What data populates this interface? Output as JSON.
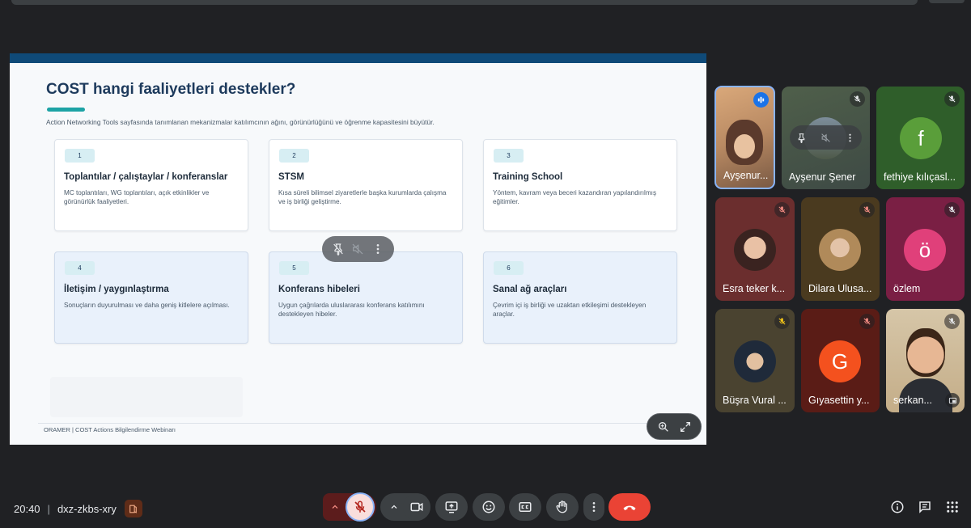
{
  "slide": {
    "title": "COST hangi faaliyetleri destekler?",
    "subtitle": "Action Networking Tools sayfasında tanımlanan mekanizmalar katılımcının ağını, görünürlüğünü ve öğrenme kapasitesini büyütür.",
    "footer": "ORAMER | COST Actions Bilgilendirme Webinarı",
    "cards": [
      {
        "num": "1",
        "title": "Toplantılar / çalıştaylar / konferanslar",
        "desc": "MC toplantıları, WG toplantıları, açık etkinlikler ve görünürlük faaliyetleri."
      },
      {
        "num": "2",
        "title": "STSM",
        "desc": "Kısa süreli bilimsel ziyaretlerle başka kurumlarda çalışma ve iş birliği geliştirme."
      },
      {
        "num": "3",
        "title": "Training School",
        "desc": "Yöntem, kavram veya beceri kazandıran yapılandırılmış eğitimler."
      },
      {
        "num": "4",
        "title": "İletişim / yaygınlaştırma",
        "desc": "Sonuçların duyurulması ve daha geniş kitlelere açılması."
      },
      {
        "num": "5",
        "title": "Konferans hibeleri",
        "desc": "Uygun çağrılarda uluslararası konferans katılımını destekleyen hibeler."
      },
      {
        "num": "6",
        "title": "Sanal ağ araçları",
        "desc": "Çevrim içi iş birliği ve uzaktan etkileşimi destekleyen araçlar."
      }
    ]
  },
  "participants": [
    {
      "name": "Ayşenur...",
      "initial": "",
      "status": "speaking"
    },
    {
      "name": "Ayşenur Şener",
      "initial": "",
      "status": "muted"
    },
    {
      "name": "fethiye kılıçasl...",
      "initial": "f",
      "status": "muted"
    },
    {
      "name": "Esra teker k...",
      "initial": "",
      "status": "muted"
    },
    {
      "name": "Dilara Ulusa...",
      "initial": "",
      "status": "muted"
    },
    {
      "name": "özlem",
      "initial": "ö",
      "status": "muted"
    },
    {
      "name": "Büşra Vural ...",
      "initial": "",
      "status": "muted"
    },
    {
      "name": "Gıyasettin y...",
      "initial": "G",
      "status": "muted"
    },
    {
      "name": "serkan...",
      "initial": "",
      "status": "muted"
    }
  ],
  "meeting": {
    "time": "20:40",
    "code": "dxz-zkbs-xry"
  },
  "colors": {
    "end_call": "#ea4335",
    "mic_muted_bg": "#f9dedc",
    "slide_band": "#0f4a78",
    "accent": "#1da3a5"
  },
  "icons": {
    "controls": [
      "chevron-up-icon",
      "mic-off-icon",
      "chevron-up-icon",
      "camera-icon",
      "present-icon",
      "emoji-icon",
      "captions-icon",
      "raise-hand-icon",
      "more-vert-icon",
      "end-call-icon"
    ],
    "right": [
      "info-icon",
      "chat-icon",
      "apps-icon"
    ]
  }
}
